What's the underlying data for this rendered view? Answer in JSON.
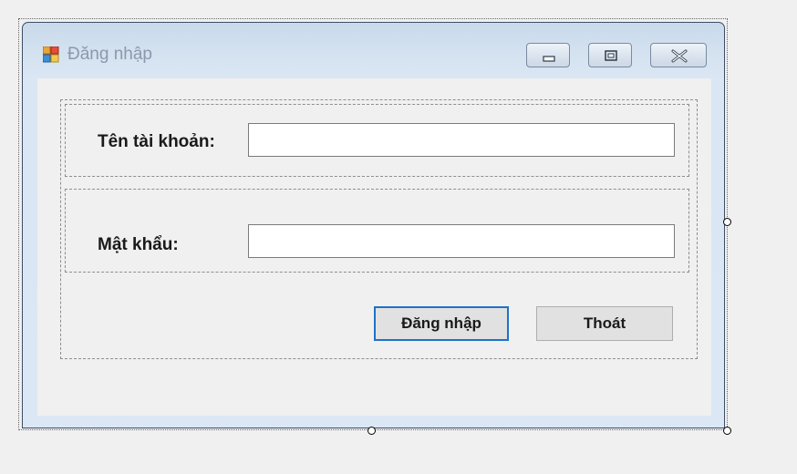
{
  "window": {
    "title": "Đăng nhập",
    "icon": "form-icon",
    "controls": [
      "minimize-icon",
      "maximize-icon",
      "close-icon"
    ]
  },
  "form": {
    "username_label": "Tên tài khoản:",
    "username_value": "",
    "password_label": "Mật khẩu:",
    "password_value": "",
    "login_button": "Đăng nhập",
    "exit_button": "Thoát"
  },
  "colors": {
    "default_button_border": "#1e72c8",
    "window_frame": "#dbe7f4",
    "client_background": "#f0f0f0"
  }
}
